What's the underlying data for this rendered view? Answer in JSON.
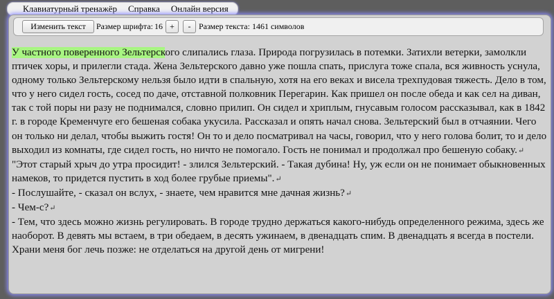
{
  "menu": {
    "items": [
      "Клавиатурный тренажёр",
      "Справка",
      "Онлайн версия"
    ]
  },
  "toolbar": {
    "change_text_label": "Изменить текст",
    "font_size_label": "Размер шрифта:",
    "font_size_value": "16",
    "plus_label": "+",
    "minus_label": "-",
    "text_size_label": "Размер текста: 1461 символов"
  },
  "text": {
    "highlighted": "У частного поверенного Зельтерск",
    "p1_rest": "ого слипались глаза. Природа погрузилась в потемки. Затихли ветерки, замолкли птичек хоры, и прилегли стада. Жена Зельтерского давно уже пошла спать, прислуга тоже спала, вся живность уснула, одному только Зельтерскому нельзя было идти в спальную, хотя на его веках и висела трехпудовая тяжесть. Дело в том, что у него сидел гость, сосед по даче, отставной полковник Перегарин. Как пришел он после обеда и как сел на диван, так с той поры ни разу не поднимался, словно прилип. Он сидел и хриплым, гнусавым голосом рассказывал, как в 1842 г. в городе Кременчуге его бешеная собака укусила. Рассказал и опять начал снова. Зельтерский был в отчаянии. Чего он только ни делал, чтобы выжить гостя! Он то и дело посматривал на часы, говорил, что у него голова болит, то и дело выходил из комнаты, где сидел гость, но ничто не помогало. Гость не понимал и продолжал про бешеную собаку.",
    "p2": "\"Этот старый хрыч до утра просидит! - злился Зельтерский. - Такая дубина! Ну, уж если он не понимает обыкновенных намеков, то придется пустить в ход более грубые приемы\".",
    "p3": "- Послушайте, - сказал он вслух, - знаете, чем нравится мне дачная жизнь?",
    "p4": "- Чем-с?",
    "p5": "- Тем, что здесь можно жизнь регулировать. В городе трудно держаться какого-нибудь определенного режима, здесь же наоборот. В девять мы встаем, в три обедаем, в десять ужинаем, в двенадцать спим. В двенадцать я всегда в постели. Храни меня бог лечь позже: не отделаться на другой день от мигрени!",
    "pilcrow": "↵"
  }
}
